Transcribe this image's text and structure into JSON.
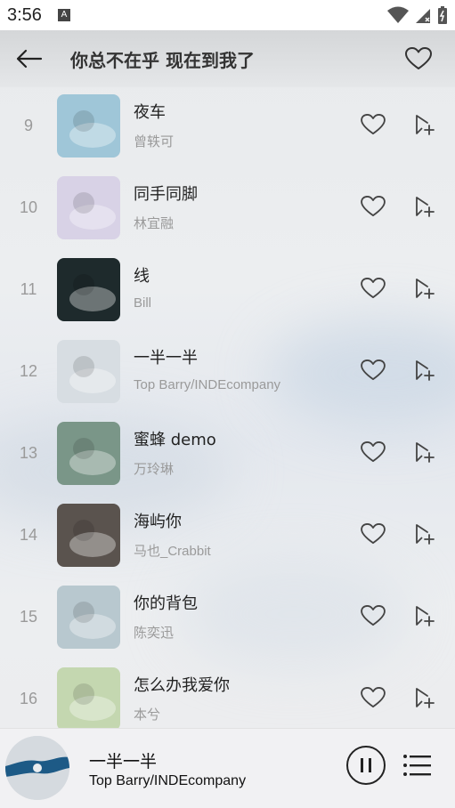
{
  "status_bar": {
    "time": "3:56",
    "notification_icon": "A"
  },
  "header": {
    "title": "你总不在乎 现在到我了"
  },
  "songs": [
    {
      "rank": "9",
      "title": "夜车",
      "artist": "曾轶可",
      "cover_color": "#9fc6d8"
    },
    {
      "rank": "10",
      "title": "同手同脚",
      "artist": "林宜融",
      "cover_color": "#d8d2e6"
    },
    {
      "rank": "11",
      "title": "线",
      "artist": "Bill",
      "cover_color": "#1e2a2c"
    },
    {
      "rank": "12",
      "title": "一半一半",
      "artist": "Top Barry/INDEcompany",
      "cover_color": "#d7dde2"
    },
    {
      "rank": "13",
      "title": "蜜蜂 demo",
      "artist": "万玲琳",
      "cover_color": "#7a9688"
    },
    {
      "rank": "14",
      "title": "海屿你",
      "artist": "马也_Crabbit",
      "cover_color": "#5a534e"
    },
    {
      "rank": "15",
      "title": "你的背包",
      "artist": "陈奕迅",
      "cover_color": "#b8c8cf"
    },
    {
      "rank": "16",
      "title": "怎么办我爱你",
      "artist": "本兮",
      "cover_color": "#c4d7b0"
    }
  ],
  "now_playing": {
    "title": "一半一半",
    "artist": "Top Barry/INDEcompany"
  },
  "colors": {
    "accent_icon": "#444444",
    "muted_text": "#9a9a9a"
  }
}
